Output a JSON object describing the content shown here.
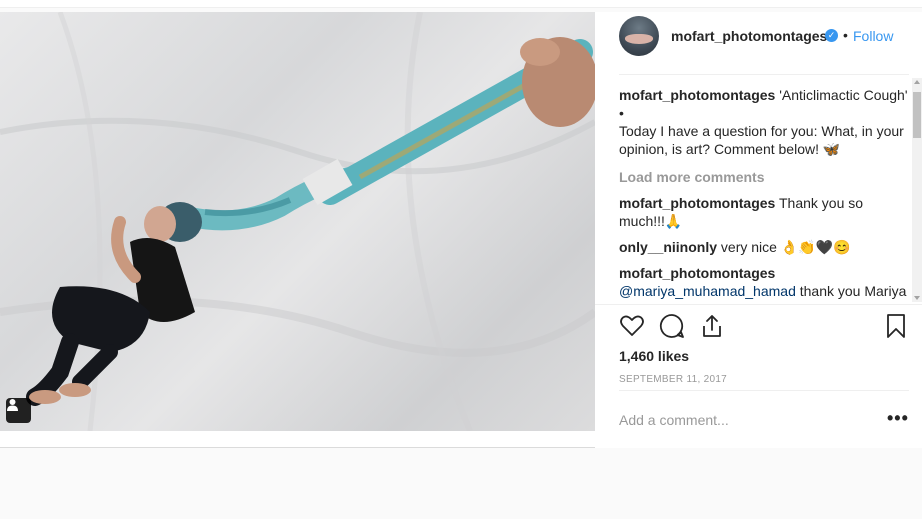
{
  "post": {
    "author": "mofart_photomontages",
    "follow_label": "Follow",
    "separator": "•",
    "verified_glyph": "✓",
    "caption": {
      "user": "mofart_photomontages",
      "text": " 'Anticlimactic Cough'",
      "bullet": "•",
      "body": "Today I have a question for you: What, in your opinion, is art? Comment below! 🦋"
    },
    "load_more_label": "Load more comments",
    "comments": [
      {
        "user": "mofart_photomontages",
        "text": " Thank you so much!!!🙏"
      },
      {
        "user": "only__niinonly",
        "text": " very nice 👌👏🖤😊"
      },
      {
        "user": "mofart_photomontages",
        "mention": " @mariya_muhamad_hamad",
        "text": " thank you Mariya ❤️"
      }
    ],
    "likes": "1,460 likes",
    "date": "SEPTEMBER 11, 2017",
    "add_comment_placeholder": "Add a comment...",
    "more_label": "•••"
  },
  "icons": {
    "like": "heart-icon",
    "comment": "comment-bubble-icon",
    "share": "share-icon",
    "save": "bookmark-icon",
    "user_tag": "person-icon",
    "verified": "verified-badge-icon"
  },
  "colors": {
    "accent": "#3897f0",
    "muted": "#999999",
    "text": "#262626"
  }
}
